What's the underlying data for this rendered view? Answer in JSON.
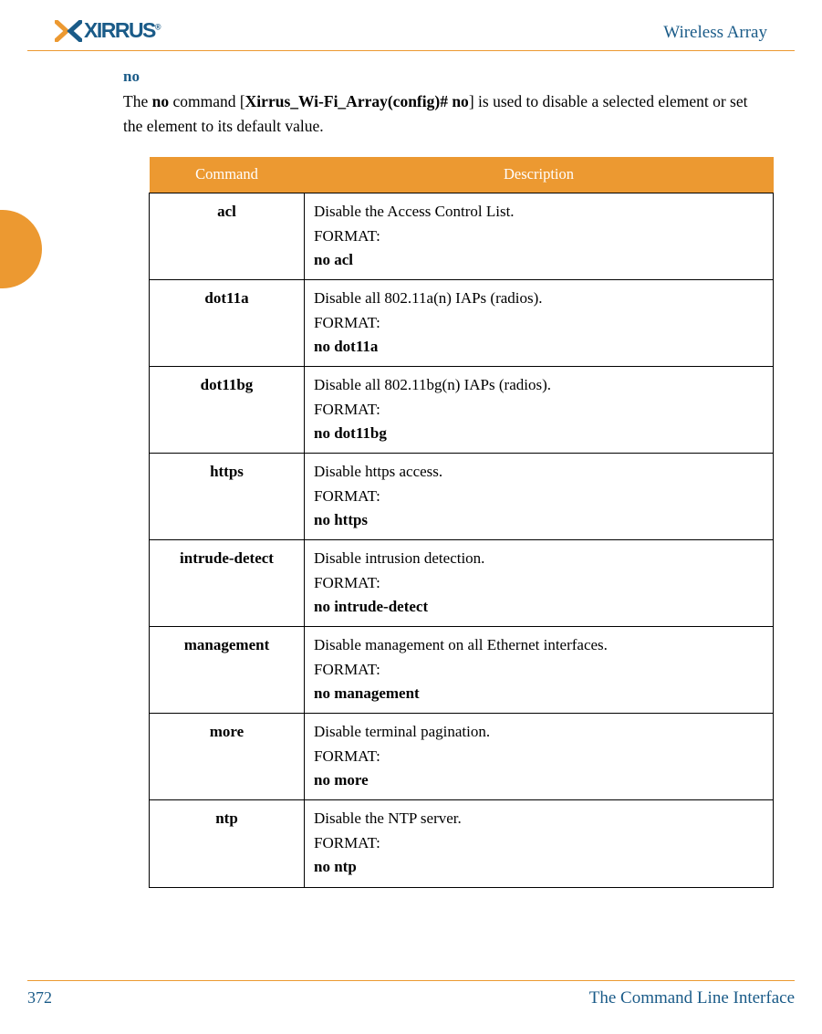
{
  "header": {
    "logo_text": "XIRRUS",
    "title": "Wireless Array"
  },
  "section": {
    "command_title": "no",
    "intro_part1": "The ",
    "intro_bold1": "no",
    "intro_part2": " command [",
    "intro_bold2": "Xirrus_Wi-Fi_Array(config)# no",
    "intro_part3": "] is used to disable a selected element or set the element to its default value."
  },
  "table": {
    "headers": {
      "command": "Command",
      "description": "Description"
    },
    "format_label": "FORMAT:",
    "rows": [
      {
        "cmd": "acl",
        "desc": "Disable the Access Control List.",
        "format": "no acl"
      },
      {
        "cmd": "dot11a",
        "desc": "Disable all 802.11a(n) IAPs (radios).",
        "format": "no dot11a"
      },
      {
        "cmd": "dot11bg",
        "desc": "Disable all 802.11bg(n) IAPs (radios).",
        "format": "no dot11bg"
      },
      {
        "cmd": "https",
        "desc": "Disable https access.",
        "format": "no https"
      },
      {
        "cmd": "intrude-detect",
        "desc": "Disable intrusion detection.",
        "format": "no intrude-detect"
      },
      {
        "cmd": "management",
        "desc": "Disable management on all Ethernet interfaces.",
        "format": "no management"
      },
      {
        "cmd": "more",
        "desc": "Disable terminal pagination.",
        "format": "no more"
      },
      {
        "cmd": "ntp",
        "desc": "Disable the NTP server.",
        "format": "no ntp"
      }
    ]
  },
  "footer": {
    "page": "372",
    "title": "The Command Line Interface"
  }
}
